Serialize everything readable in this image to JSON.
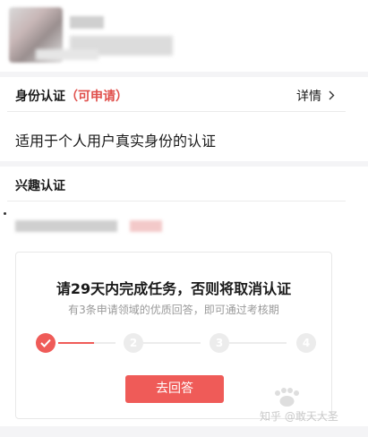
{
  "identity": {
    "title": "身份认证",
    "status": "（可申请）",
    "details_label": "详情",
    "description": "适用于个人用户真实身份的认证"
  },
  "interest": {
    "title": "兴趣认证"
  },
  "task_card": {
    "title": "请29天内完成任务，否则将取消认证",
    "subtitle": "有3条申请领域的优质回答，即可通过考核期",
    "progress": {
      "completed_steps": 1,
      "total_steps": 4
    },
    "steps": [
      "",
      "2",
      "3",
      "4"
    ],
    "button_label": "去回答"
  },
  "watermark": {
    "text": "知乎 @敢天大圣"
  },
  "colors": {
    "accent": "#ef5b58",
    "status": "#e0504c",
    "inactive": "#ececec",
    "band": "#f4f4f6"
  },
  "icons": {
    "details": "chevron-right-icon",
    "step_done": "check-icon"
  }
}
